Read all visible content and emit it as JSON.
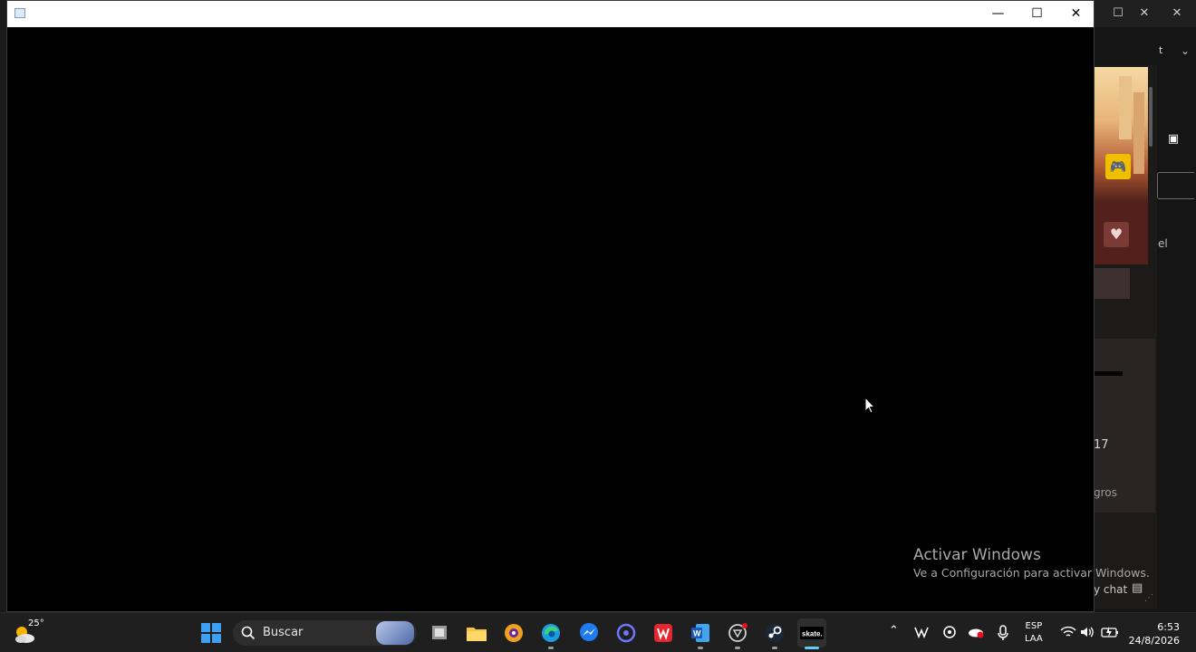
{
  "background_app": {
    "partial_label_top": "t",
    "partial_label_mid": "el",
    "card_number": "17",
    "card_text": "gros",
    "chat_label": "y chat"
  },
  "window": {
    "title": "",
    "minimize_symbol": "—",
    "maximize_symbol": "☐",
    "close_symbol": "✕"
  },
  "watermark": {
    "title": "Activar Windows",
    "subtitle": "Ve a Configuración para activar Windows."
  },
  "taskbar": {
    "weather": {
      "temperature": "25°",
      "icon": "partly-cloudy-icon"
    },
    "search": {
      "placeholder": "Buscar"
    },
    "apps": [
      {
        "name": "windows-start",
        "icon": "windows-logo-icon"
      },
      {
        "name": "task-view",
        "icon": "task-view-icon"
      },
      {
        "name": "file-explorer",
        "icon": "folder-icon"
      },
      {
        "name": "launcher",
        "icon": "circle-app-icon"
      },
      {
        "name": "edge",
        "icon": "edge-icon"
      },
      {
        "name": "messenger",
        "icon": "messenger-icon"
      },
      {
        "name": "app-ring",
        "icon": "ring-icon"
      },
      {
        "name": "wps",
        "icon": "wps-icon"
      },
      {
        "name": "word",
        "icon": "word-icon"
      },
      {
        "name": "chatgpt",
        "icon": "openai-icon"
      },
      {
        "name": "steam",
        "icon": "steam-icon"
      },
      {
        "name": "skate",
        "icon": "skate-icon",
        "label": "skate."
      }
    ],
    "tray": {
      "language": "ESP",
      "layout": "LAA",
      "time": "6:53",
      "date": "24/8/2026"
    }
  }
}
